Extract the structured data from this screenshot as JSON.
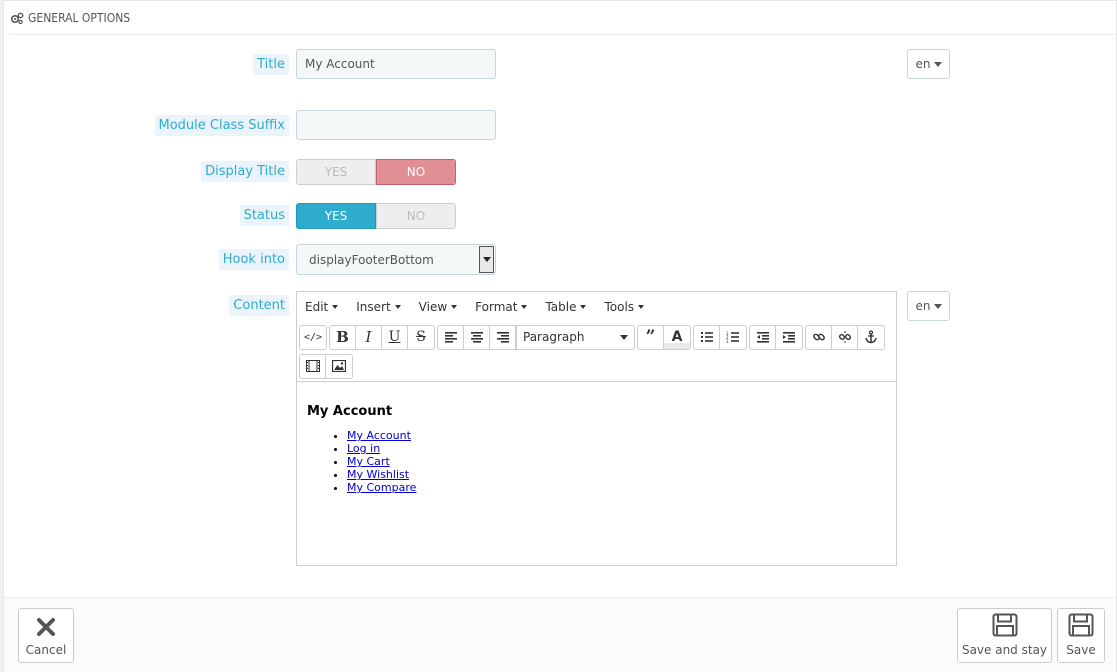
{
  "header": {
    "title": "GENERAL OPTIONS",
    "icon": "cogs-icon"
  },
  "fields": {
    "title_label": "Title",
    "title_value": "My Account",
    "title_lang": "en",
    "suffix_label": "Module Class Suffix",
    "suffix_value": "",
    "display_title_label": "Display Title",
    "display_title_yes": "YES",
    "display_title_no": "NO",
    "display_title_selected": "NO",
    "status_label": "Status",
    "status_yes": "YES",
    "status_no": "NO",
    "status_selected": "YES",
    "hook_label": "Hook into",
    "hook_value": "displayFooterBottom",
    "content_label": "Content",
    "content_lang": "en"
  },
  "editor": {
    "menus": [
      "Edit",
      "Insert",
      "View",
      "Format",
      "Table",
      "Tools"
    ],
    "block_format": "Paragraph",
    "content_heading": "My Account",
    "content_links": [
      "My Account",
      "Log in",
      "My Cart",
      "My Wishlist",
      "My Compare"
    ]
  },
  "footer": {
    "cancel_label": "Cancel",
    "save_stay_label": "Save and stay",
    "save_label": "Save"
  },
  "colors": {
    "accent": "#2eacce",
    "no_active": "#e08f95"
  }
}
